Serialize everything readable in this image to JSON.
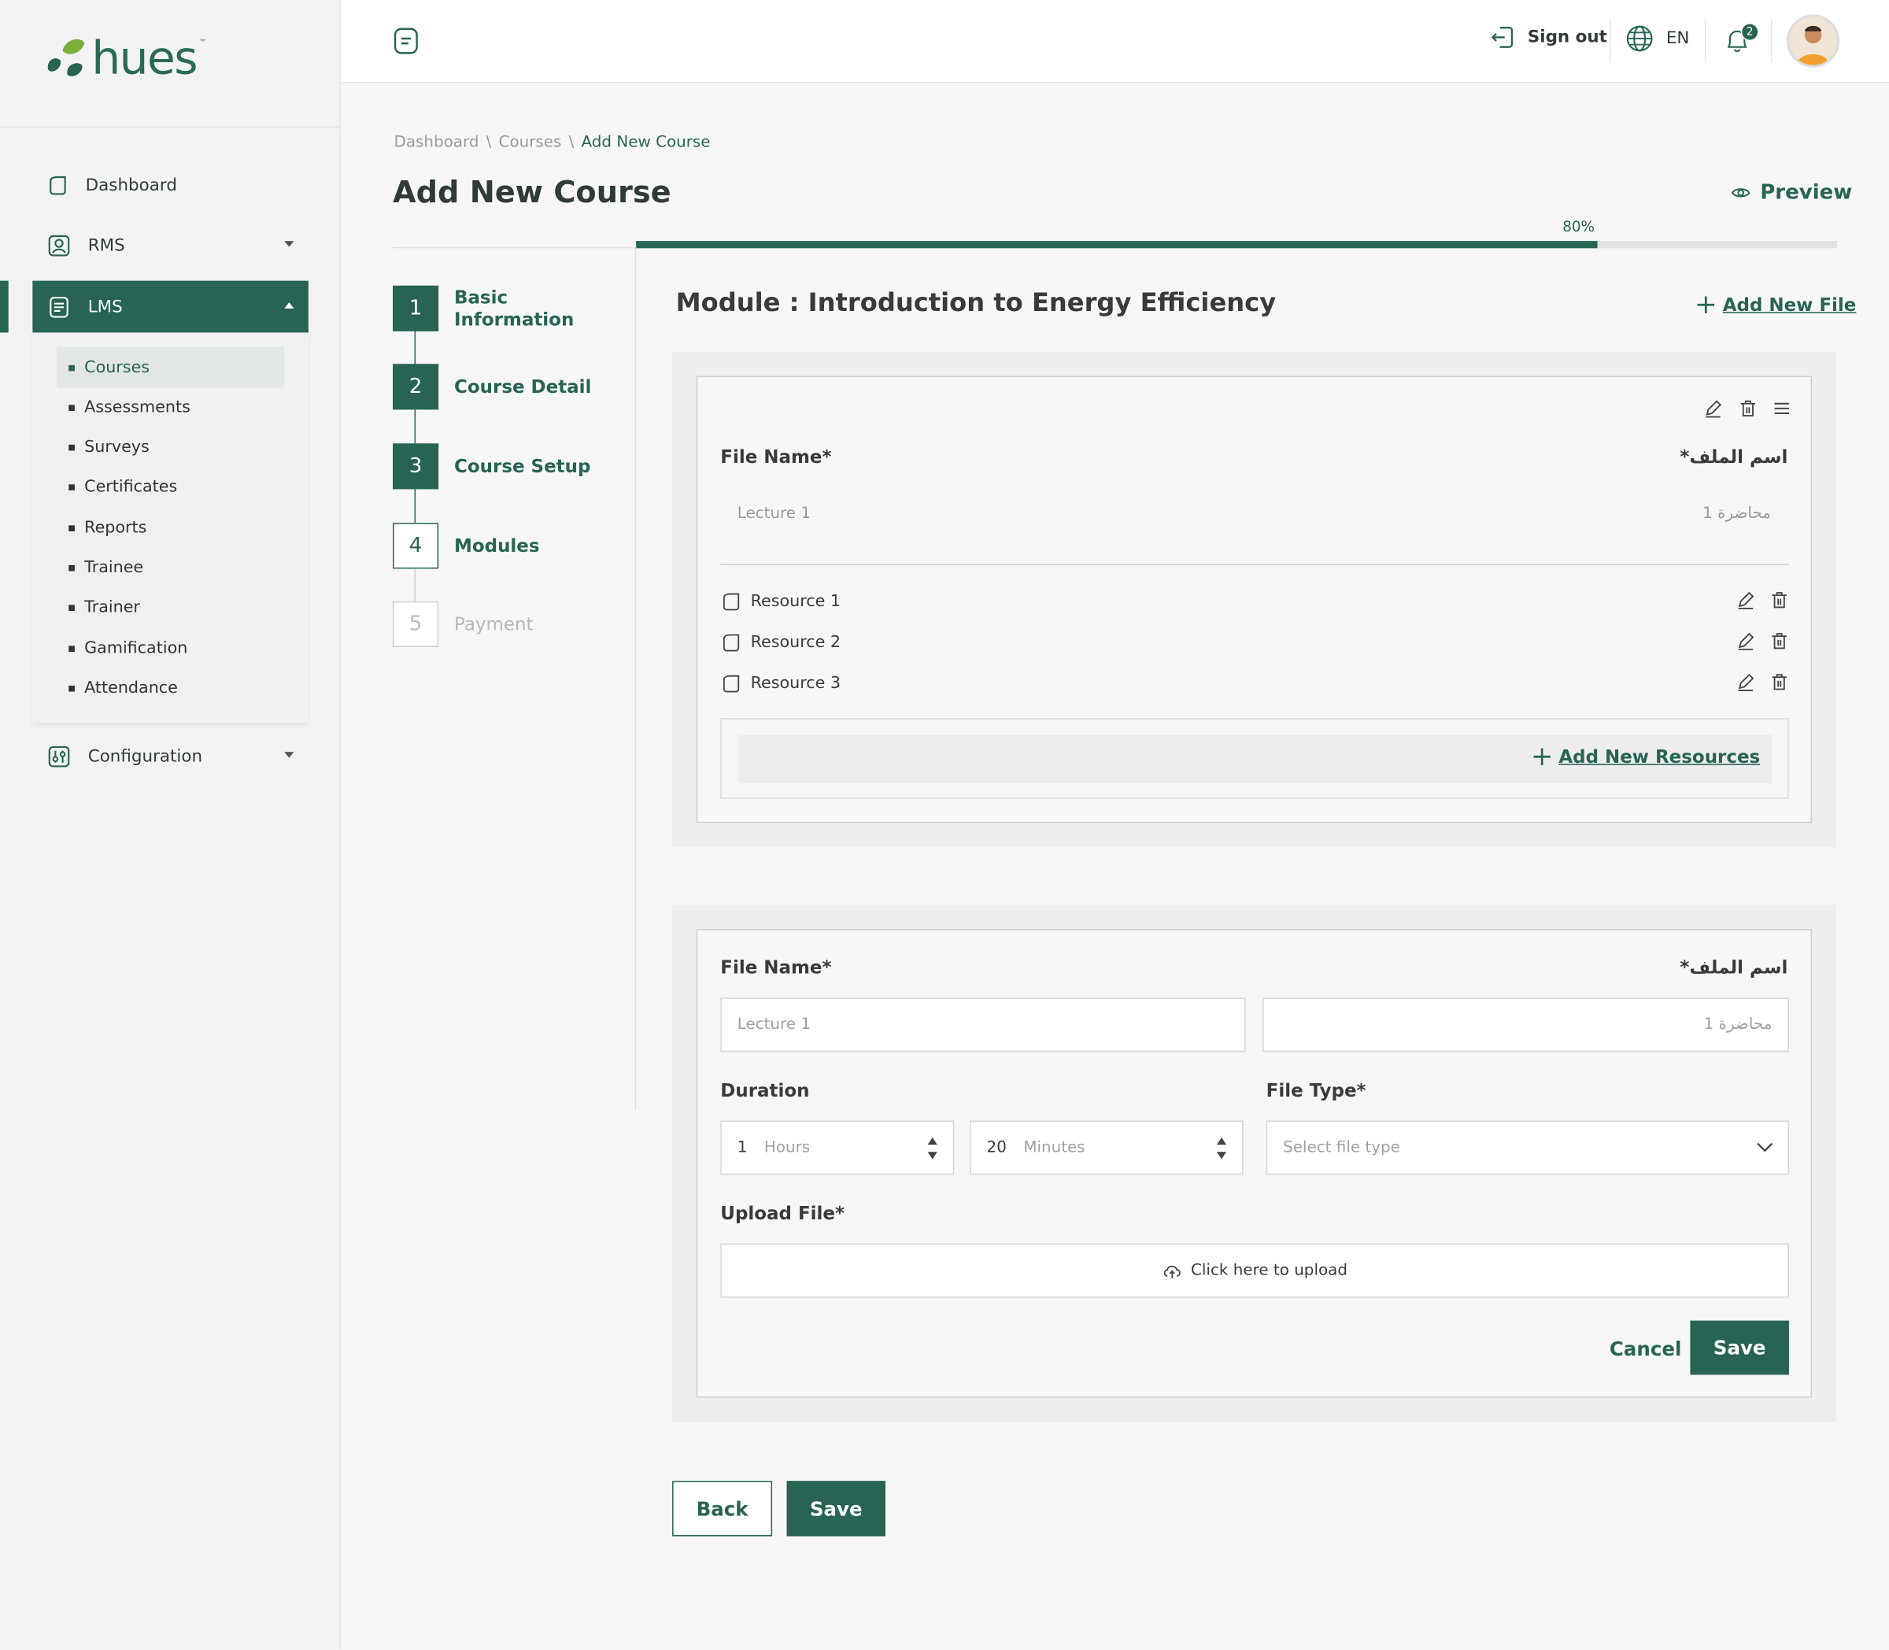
{
  "brand": {
    "name": "hues",
    "tm": "™"
  },
  "sidebar": {
    "items": [
      {
        "label": "Dashboard"
      },
      {
        "label": "RMS"
      },
      {
        "label": "LMS"
      },
      {
        "label": "Configuration"
      }
    ],
    "lms_sub": [
      {
        "label": "Courses",
        "active": true
      },
      {
        "label": "Assessments"
      },
      {
        "label": "Surveys"
      },
      {
        "label": "Certificates"
      },
      {
        "label": "Reports"
      },
      {
        "label": "Trainee"
      },
      {
        "label": "Trainer"
      },
      {
        "label": "Gamification"
      },
      {
        "label": "Attendance"
      }
    ]
  },
  "topbar": {
    "sign_out": "Sign out",
    "language": "EN",
    "notifications": "2"
  },
  "breadcrumb": {
    "items": [
      "Dashboard",
      "Courses"
    ],
    "sep": "\\",
    "current": "Add New Course"
  },
  "page": {
    "title": "Add New Course",
    "preview": "Preview"
  },
  "progress": {
    "label": "80%",
    "value": 0.8
  },
  "steps": [
    {
      "num": "1",
      "label": "Basic Information",
      "state": "done"
    },
    {
      "num": "2",
      "label": "Course Detail",
      "state": "done"
    },
    {
      "num": "3",
      "label": "Course Setup",
      "state": "done"
    },
    {
      "num": "4",
      "label": "Modules",
      "state": "current"
    },
    {
      "num": "5",
      "label": "Payment",
      "state": "todo"
    }
  ],
  "module": {
    "title": "Module : Introduction to Energy Efficiency",
    "add_file": "Add New File"
  },
  "file_card": {
    "file_name_label": "File Name*",
    "file_name_label_ar": "اسم الملف*",
    "file_name_value": "Lecture 1",
    "file_name_value_ar": "محاضرة 1",
    "resources": [
      "Resource 1",
      "Resource 2",
      "Resource 3"
    ],
    "add_resources": "Add New Resources"
  },
  "new_file": {
    "file_name_label": "File Name*",
    "file_name_label_ar": "اسم الملف*",
    "file_name_placeholder": "Lecture 1",
    "file_name_placeholder_ar": "محاضرة 1",
    "duration_label": "Duration",
    "hours_value": "1",
    "hours_unit": "Hours",
    "minutes_value": "20",
    "minutes_unit": "Minutes",
    "file_type_label": "File Type*",
    "file_type_placeholder": "Select file type",
    "upload_label": "Upload File*",
    "upload_text": "Click here to upload",
    "cancel": "Cancel",
    "save": "Save"
  },
  "footer": {
    "back": "Back",
    "save": "Save"
  },
  "colors": {
    "primary": "#276454",
    "accent_leaf": "#7ab03a"
  }
}
